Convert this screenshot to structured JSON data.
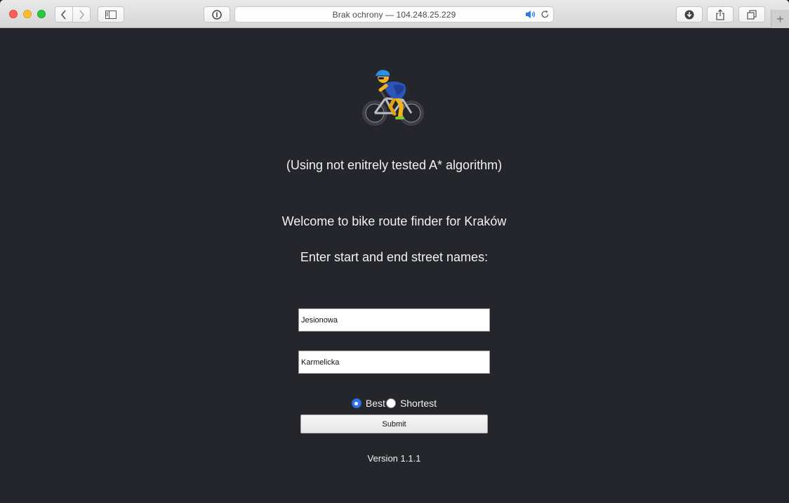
{
  "browser": {
    "address_text": "Brak ochrony — 104.248.25.229",
    "new_tab_label": "+"
  },
  "page": {
    "hero_icon": "person-biking-emoji",
    "subtitle": "(Using not enitrely tested A* algorithm)",
    "welcome": "Welcome to bike route finder for Kraków",
    "instruction": "Enter start and end street names:",
    "start_field": {
      "value": "Jesionowa"
    },
    "end_field": {
      "value": "Karmelicka"
    },
    "route_options": [
      {
        "label": "Best",
        "selected": true
      },
      {
        "label": "Shortest",
        "selected": false
      }
    ],
    "submit_label": "Submit",
    "version": "Version 1.1.1"
  },
  "colors": {
    "page_background": "#24262b",
    "text": "#f2f2f2",
    "radio_accent": "#2f73e8"
  }
}
